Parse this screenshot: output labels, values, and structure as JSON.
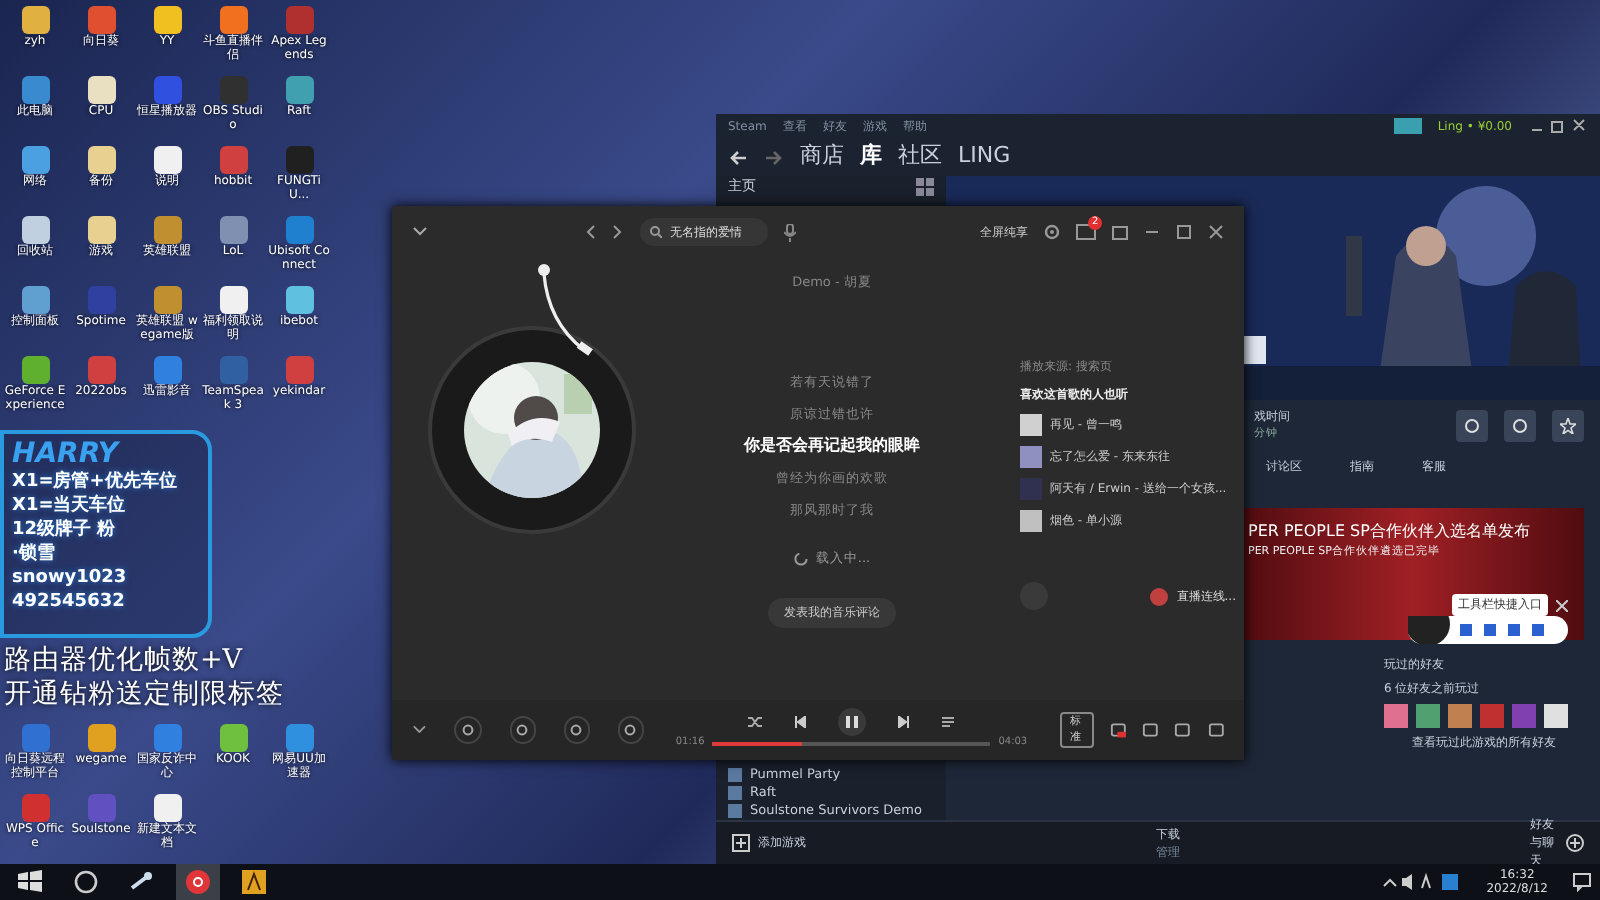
{
  "desktop": {
    "top_icons": [
      {
        "label": "zyh",
        "color": "#e0b040"
      },
      {
        "label": "向日葵",
        "color": "#e05030"
      },
      {
        "label": "YY",
        "color": "#f0c020"
      },
      {
        "label": "斗鱼直播伴侣",
        "color": "#f07020"
      },
      {
        "label": "Apex Legends",
        "color": "#b03030"
      },
      {
        "label": "此电脑",
        "color": "#3a8ad0"
      },
      {
        "label": "CPU",
        "color": "#e8e0c0"
      },
      {
        "label": "恒星播放器",
        "color": "#3050e0"
      },
      {
        "label": "OBS Studio",
        "color": "#303030"
      },
      {
        "label": "Raft",
        "color": "#40a0b0"
      },
      {
        "label": "网络",
        "color": "#4aa0e0"
      },
      {
        "label": "备份",
        "color": "#e8d090"
      },
      {
        "label": "说明",
        "color": "#f0f0f0"
      },
      {
        "label": "hobbit",
        "color": "#d04040"
      },
      {
        "label": "FUNGTiU...",
        "color": "#202020"
      },
      {
        "label": "回收站",
        "color": "#c0d0e0"
      },
      {
        "label": "游戏",
        "color": "#e8d090"
      },
      {
        "label": "英雄联盟",
        "color": "#c09030"
      },
      {
        "label": "LoL",
        "color": "#8090b0"
      },
      {
        "label": "Ubisoft Connect",
        "color": "#2080d0"
      },
      {
        "label": "控制面板",
        "color": "#60a0d0"
      },
      {
        "label": "Spotime",
        "color": "#3040a0"
      },
      {
        "label": "英雄联盟 wegame版",
        "color": "#c09030"
      },
      {
        "label": "福利领取说明",
        "color": "#f0f0f0"
      },
      {
        "label": "ibebot",
        "color": "#60c0e0"
      },
      {
        "label": "GeForce Experience",
        "color": "#60b030"
      },
      {
        "label": "2022obs",
        "color": "#d04040"
      },
      {
        "label": "迅雷影音",
        "color": "#3080e0"
      },
      {
        "label": "TeamSpeak 3",
        "color": "#3060a0"
      },
      {
        "label": "yekindar",
        "color": "#d04040"
      }
    ],
    "promo": {
      "title": "HARRY",
      "lines": [
        "X1=房管+优先车位",
        "X1=当天车位",
        "12级牌子 粉",
        "·锁雪",
        "snowy1023",
        "492545632"
      ],
      "banner": [
        "路由器优化帧数+V",
        "开通钻粉送定制限标签"
      ]
    },
    "bottom_icons": [
      {
        "label": "向日葵远程控制平台",
        "color": "#3070d0"
      },
      {
        "label": "wegame",
        "color": "#e0a020"
      },
      {
        "label": "国家反诈中心",
        "color": "#3080e0"
      },
      {
        "label": "KOOK",
        "color": "#70c040"
      },
      {
        "label": "网易UU加速器",
        "color": "#3090e0"
      },
      {
        "label": "WPS Office",
        "color": "#d03030"
      },
      {
        "label": "Soulstone",
        "color": "#6050c0"
      },
      {
        "label": "新建文本文档",
        "color": "#f0f0f0"
      }
    ]
  },
  "steam": {
    "menu": [
      "Steam",
      "查看",
      "好友",
      "游戏",
      "帮助"
    ],
    "account": "Ling • ¥0.00",
    "nav": [
      {
        "label": "商店",
        "selected": false
      },
      {
        "label": "库",
        "selected": true
      },
      {
        "label": "社区",
        "selected": false
      },
      {
        "label": "LING",
        "selected": false
      }
    ],
    "sidebar_home": "主页",
    "games": [
      "Pummel Party",
      "Raft",
      "Soulstone Survivors Demo"
    ],
    "play_time_label": "戏时间",
    "play_time": "分钟",
    "game_tabs": [
      "讨论区",
      "指南",
      "客服"
    ],
    "news": {
      "title": "PER PEOPLE SP合作伙伴入选名单发布",
      "subtitle": "PER PEOPLE SP合作伙伴遴选已完毕"
    },
    "friends": {
      "heading": "玩过的好友",
      "count": "6 位好友之前玩过",
      "avatars": [
        {
          "color": "#e07090"
        },
        {
          "color": "#50a070"
        },
        {
          "color": "#c08050"
        },
        {
          "color": "#c03030"
        },
        {
          "color": "#8040b0"
        },
        {
          "color": "#e0e0e0"
        }
      ],
      "link": "查看玩过此游戏的所有好友"
    },
    "toolbar_popup": "工具栏快捷入口",
    "footer": {
      "add_game": "添加游戏",
      "downloads": "下载",
      "downloads_sub": "管理",
      "friends_chat": "好友与聊天"
    }
  },
  "music_player": {
    "search": "无名指的爱情",
    "fullscreen": "全屏纯享",
    "mail_badge": "2",
    "lyrics": [
      {
        "text": "Demo - 胡夏",
        "current": false
      },
      {
        "text": "若有天说错了",
        "current": false
      },
      {
        "text": "原谅过错也许",
        "current": false
      },
      {
        "text": "你是否会再记起我的眼眸",
        "current": true
      },
      {
        "text": "曾经为你画的欢歌",
        "current": false
      },
      {
        "text": "那风那时了我",
        "current": false
      }
    ],
    "loading": "载入中...",
    "source": "播放来源: 搜索页",
    "recommend_title": "喜欢这首歌的人也听",
    "recommendations": [
      {
        "title": "再见 - 曾一鸣",
        "color": "#d0d0d0"
      },
      {
        "title": "忘了怎么爱 - 东来东往",
        "color": "#9090c0"
      },
      {
        "title": "阿天有 / Erwin - 送给一个女孩...",
        "color": "#303050"
      },
      {
        "title": "烟色 - 单小源",
        "color": "#c0c0c0"
      }
    ],
    "comment_button": "发表我的音乐评论",
    "live_button": "直播连线...",
    "playing": true,
    "level": 0.32,
    "elapsed": "01:16",
    "duration": "04:03",
    "quality": "标准"
  },
  "taskbar": {
    "apps": [
      {
        "kind": "start"
      },
      {
        "kind": "circle"
      },
      {
        "kind": "steam"
      },
      {
        "kind": "music",
        "selected": true
      },
      {
        "kind": "game",
        "selected": false
      }
    ],
    "time": "16:32",
    "date": "2022/8/12"
  }
}
